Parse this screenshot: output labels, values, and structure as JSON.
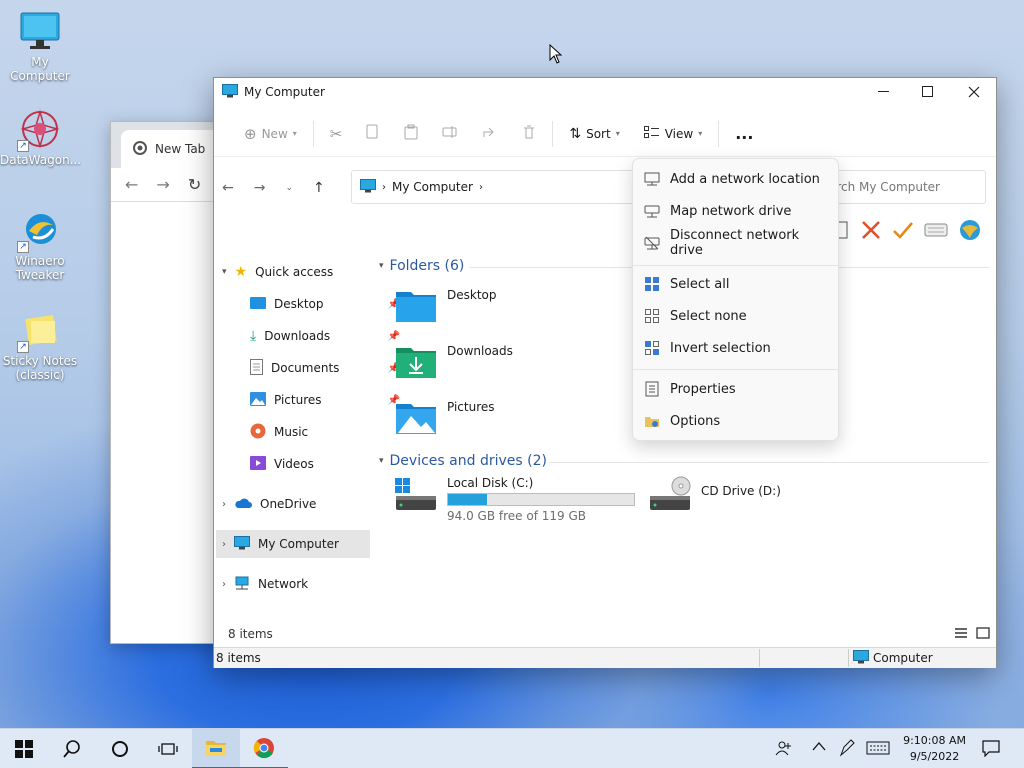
{
  "desktop": {
    "icons": [
      {
        "label": "My Computer"
      },
      {
        "label": "DataWagon..."
      },
      {
        "label": "Winaero Tweaker"
      },
      {
        "label": "Sticky Notes (classic)"
      }
    ]
  },
  "chrome": {
    "tab_label": "New Tab"
  },
  "explorer": {
    "title": "My Computer",
    "toolbar": {
      "new_label": "New",
      "sort_label": "Sort",
      "view_label": "View",
      "more_label": "..."
    },
    "address": {
      "location": "My Computer"
    },
    "search": {
      "placeholder": "Search My Computer",
      "shown_text": "arch My Computer"
    },
    "nav_pane": {
      "quick_access": "Quick access",
      "items": [
        {
          "label": "Desktop"
        },
        {
          "label": "Downloads"
        },
        {
          "label": "Documents"
        },
        {
          "label": "Pictures"
        },
        {
          "label": "Music"
        },
        {
          "label": "Videos"
        }
      ],
      "onedrive": "OneDrive",
      "my_computer": "My Computer",
      "network": "Network"
    },
    "folders_header": "Folders (6)",
    "folders": [
      {
        "label": "Desktop"
      },
      {
        "label": "Downloads"
      },
      {
        "label": "Pictures"
      }
    ],
    "devices_header": "Devices and drives (2)",
    "drives": [
      {
        "label": "Local Disk (C:)",
        "free": "94.0 GB free of 119 GB",
        "used_fraction": 0.21
      },
      {
        "label": "CD Drive (D:)"
      }
    ],
    "item_count": "8 items",
    "statusbar": {
      "count": "8 items",
      "location": "Computer"
    }
  },
  "menu": {
    "items": [
      {
        "label": "Add a network location"
      },
      {
        "label": "Map network drive"
      },
      {
        "label": "Disconnect network drive"
      },
      {
        "label": "Select all"
      },
      {
        "label": "Select none"
      },
      {
        "label": "Invert selection"
      },
      {
        "label": "Properties"
      },
      {
        "label": "Options"
      }
    ]
  },
  "taskbar": {
    "time": "9:10:08 AM",
    "date": "9/5/2022"
  },
  "colors": {
    "accent": "#0067c0",
    "folder": "#1e90e0",
    "drive_bar": "#26a0da"
  }
}
